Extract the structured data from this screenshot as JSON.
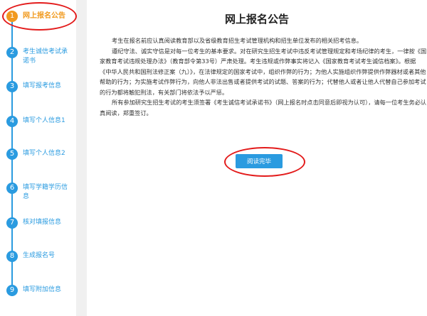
{
  "sidebar": {
    "steps": [
      {
        "num": "1",
        "label": "网上报名公告"
      },
      {
        "num": "2",
        "label": "考生诚信考试承诺书"
      },
      {
        "num": "3",
        "label": "填写报考信息"
      },
      {
        "num": "4",
        "label": "填写个人信息1"
      },
      {
        "num": "5",
        "label": "填写个人信息2"
      },
      {
        "num": "6",
        "label": "填写学籍学历信息"
      },
      {
        "num": "7",
        "label": "核对填报信息"
      },
      {
        "num": "8",
        "label": "生成报名号"
      },
      {
        "num": "9",
        "label": "填写附加信息"
      }
    ]
  },
  "main": {
    "title": "网上报名公告",
    "paragraphs": [
      "考生在报名前应认真阅读教育部以及省级教育招生考试管理机构和招生单位发布的相关招考信息。",
      "遵纪守法、诚实守信是对每一位考生的基本要求。对在研究生招生考试中违反考试管理规定和考场纪律的考生，一律按《国家教育考试违规处理办法》（教育部令第33号）严肃处理。考生违规或作弊事实将记入《国家教育考试考生诚信档案》。根据《中华人民共和国刑法修正案（九）》，在法律规定的国家考试中，组织作弊的行为；为他人实施组织作弊提供作弊器材或者其他帮助的行为；为实施考试作弊行为，向他人非法出售或者提供考试的试题、答案的行为；代替他人或者让他人代替自己参加考试的行为都将触犯刑法，有关部门将依法予以严惩。",
      "所有参加研究生招生考试的考生须签署《考生诚信考试承诺书》（网上报名时点击同意后即视为认可），请每一位考生务必认真阅读，郑重签订。"
    ],
    "finish_button": "阅读完毕"
  }
}
